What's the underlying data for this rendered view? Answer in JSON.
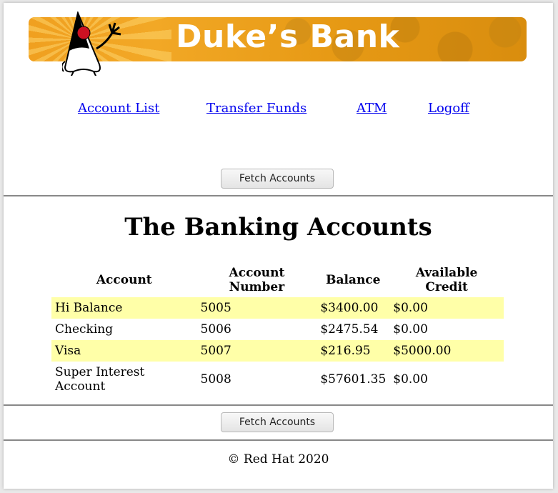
{
  "banner": {
    "title": "Duke’s Bank",
    "logo": "duke-mascot"
  },
  "nav": [
    {
      "label": "Account List"
    },
    {
      "label": "Transfer Funds"
    },
    {
      "label": "ATM"
    },
    {
      "label": "Logoff"
    }
  ],
  "buttons": {
    "fetch_top": "Fetch Accounts",
    "fetch_bottom": "Fetch Accounts"
  },
  "heading": "The Banking Accounts",
  "table": {
    "columns": [
      "Account",
      "Account Number",
      "Balance",
      "Available Credit"
    ],
    "rows": [
      {
        "account": "Hi Balance",
        "number": "5005",
        "balance": "$3400.00",
        "credit": "$0.00"
      },
      {
        "account": "Checking",
        "number": "5006",
        "balance": "$2475.54",
        "credit": "$0.00"
      },
      {
        "account": "Visa",
        "number": "5007",
        "balance": "$216.95",
        "credit": "$5000.00"
      },
      {
        "account": "Super Interest Account",
        "number": "5008",
        "balance": "$57601.35",
        "credit": "$0.00"
      }
    ]
  },
  "footer": "© Red Hat 2020",
  "colors": {
    "banner": "#f0a020",
    "row_highlight": "#ffffa8",
    "link": "#0000ee"
  }
}
